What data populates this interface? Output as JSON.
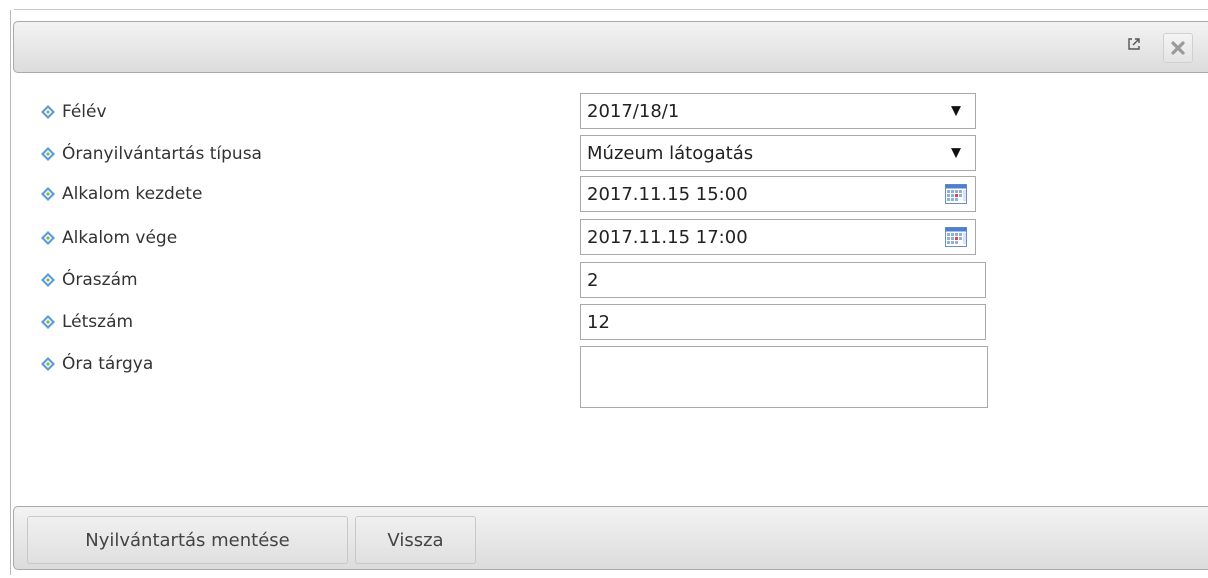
{
  "dialog": {
    "popout_icon": "external-link-icon",
    "close_icon": "close-icon"
  },
  "form": {
    "semester": {
      "label": "Félév",
      "value": "2017/18/1"
    },
    "record_type": {
      "label": "Óranyilvántartás típusa",
      "value": "Múzeum látogatás"
    },
    "start": {
      "label": "Alkalom kezdete",
      "value": "2017.11.15 15:00"
    },
    "end": {
      "label": "Alkalom vége",
      "value": "2017.11.15 17:00"
    },
    "hours": {
      "label": "Óraszám",
      "value": "2"
    },
    "headcount": {
      "label": "Létszám",
      "value": "12"
    },
    "subject": {
      "label": "Óra tárgya",
      "value": ""
    }
  },
  "footer": {
    "save_label": "Nyilvántartás mentése",
    "back_label": "Vissza"
  }
}
